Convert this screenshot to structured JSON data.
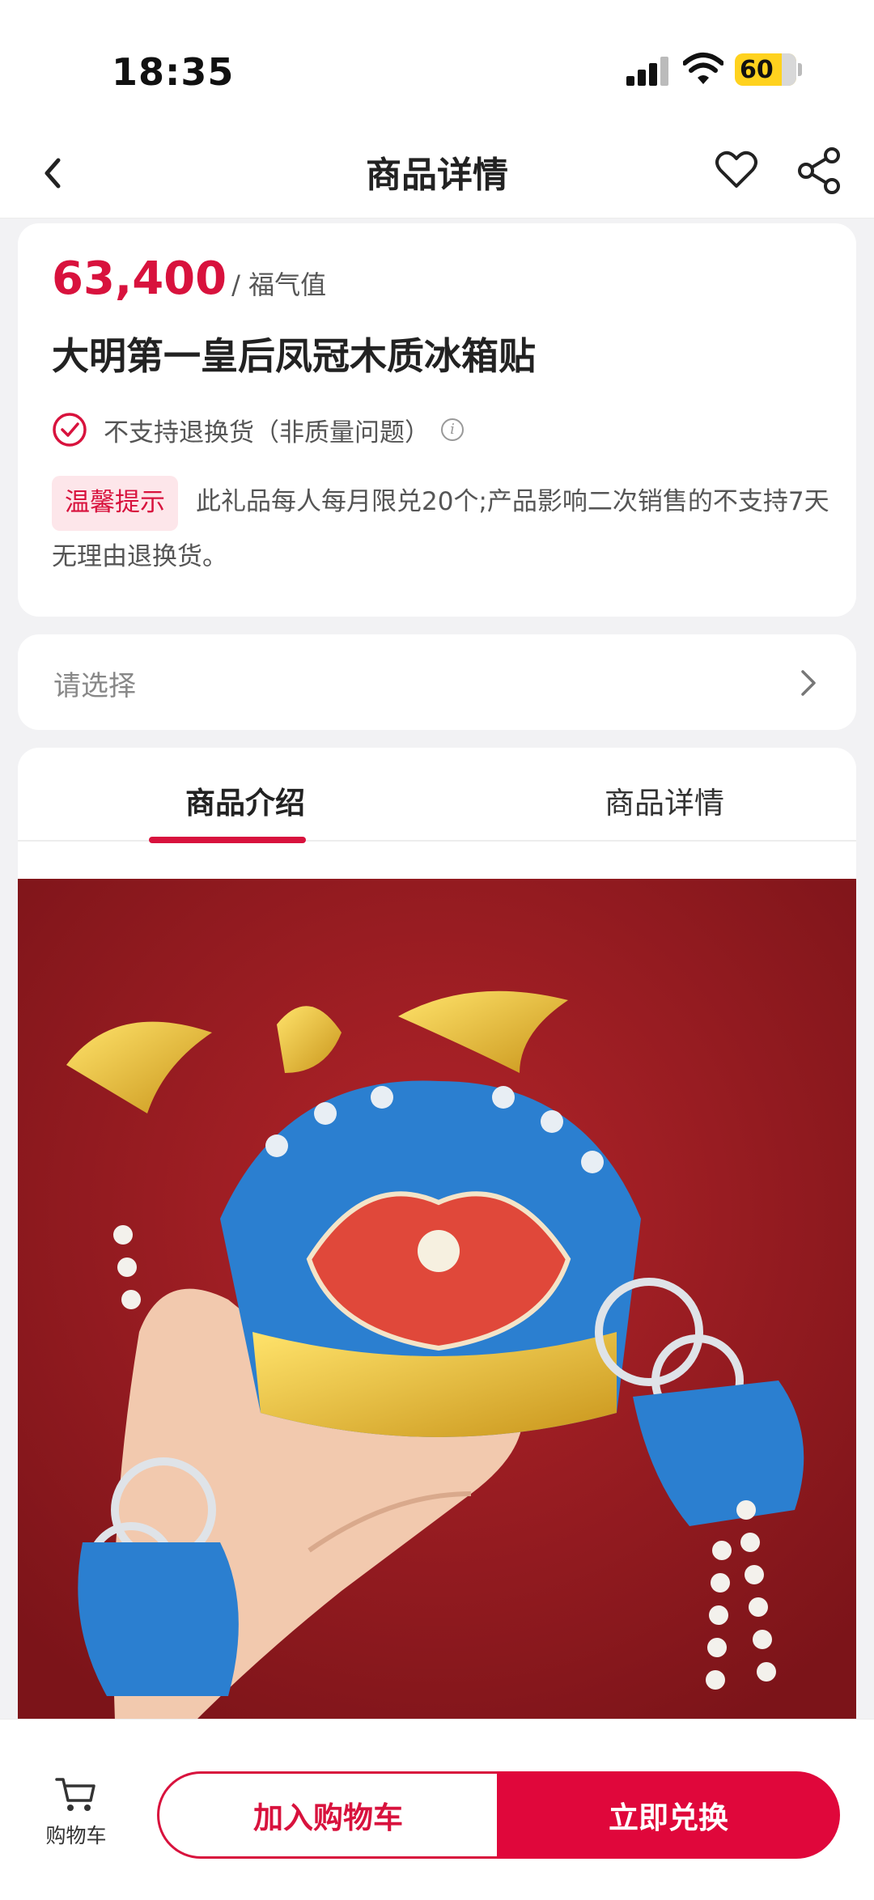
{
  "status_bar": {
    "time": "18:35",
    "battery": "60"
  },
  "navbar": {
    "title": "商品详情",
    "icons": [
      "back-icon",
      "heart-icon",
      "share-icon"
    ]
  },
  "product": {
    "price": "63,400",
    "price_unit": "/ 福气值",
    "title": "大明第一皇后凤冠木质冰箱贴",
    "return_policy": "不支持退换货（非质量问题）",
    "notice_tag": "温馨提示",
    "notice_text": "此礼品每人每月限兑20个;产品影响二次销售的不支持7天无理由退换货。"
  },
  "select": {
    "placeholder": "请选择"
  },
  "tabs": [
    {
      "label": "商品介绍",
      "active": true
    },
    {
      "label": "商品详情",
      "active": false
    }
  ],
  "bottom_bar": {
    "cart_label": "购物车",
    "add_to_cart": "加入购物车",
    "redeem_now": "立即兑换"
  },
  "colors": {
    "accent": "#d8123d",
    "button_red": "#e0073b",
    "notice_bg": "#fde6ea",
    "image_bg": "#8e1a1f"
  }
}
